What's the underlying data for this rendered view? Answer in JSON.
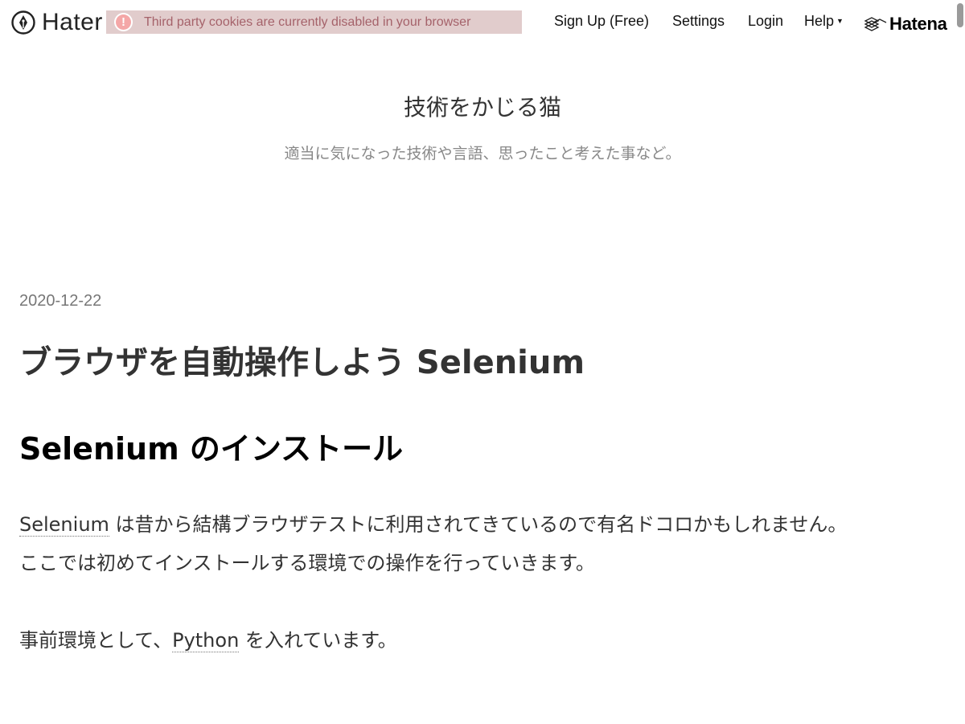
{
  "header": {
    "brand": {
      "text": "Hater",
      "icon": "pen-nib-icon"
    },
    "cookie_notice": {
      "icon": "exclamation-icon",
      "text": "Third party cookies are currently disabled in your browser"
    },
    "nav": {
      "signup": "Sign Up (Free)",
      "settings": "Settings",
      "login": "Login",
      "help": "Help"
    },
    "hatena_logo": "Hatena"
  },
  "blog": {
    "title": "技術をかじる猫",
    "description": "適当に気になった技術や言語、思ったこと考えた事など。"
  },
  "entry": {
    "date": "2020-12-22",
    "title": "ブラウザを自動操作しよう Selenium",
    "section_heading": "Selenium のインストール",
    "para1": {
      "keyword": "Selenium",
      "text": " は昔から結構ブラウザテストに利用されてきているので有名ドコロかもしれません。"
    },
    "para2": "ここでは初めてインストールする環境での操作を行っていきます。",
    "para3": {
      "before": "事前環境として、",
      "keyword": "Python",
      "after": " を入れています。"
    }
  },
  "colors": {
    "cookie_bg": "#e1cccc",
    "cookie_text": "#a5626a",
    "text": "#333333",
    "muted": "#888888"
  }
}
